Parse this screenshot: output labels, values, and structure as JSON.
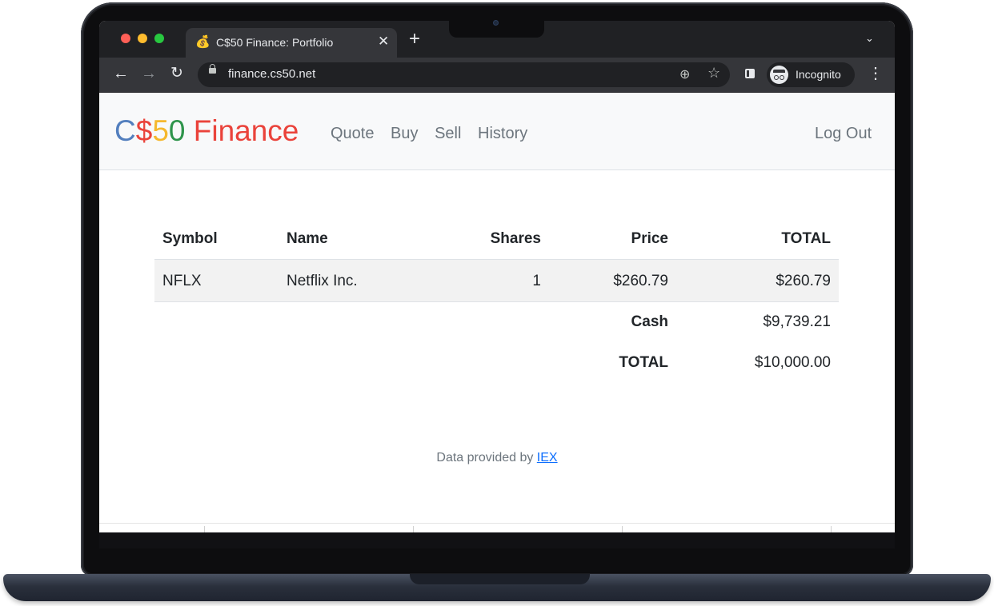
{
  "browser": {
    "tab_title": "C$50 Finance: Portfolio",
    "tab_favicon": "💰",
    "url": "finance.cs50.net",
    "profile_label": "Incognito",
    "icons": [
      "back-arrow-icon",
      "forward-arrow-icon",
      "reload-icon",
      "lock-icon",
      "zoom-icon",
      "star-icon",
      "side-panel-icon",
      "incognito-icon",
      "kebab-menu-icon",
      "close-icon",
      "plus-icon",
      "chevron-down-icon"
    ]
  },
  "navbar": {
    "brand": {
      "c": "C",
      "dollar": "$",
      "five": "5",
      "zero": "0",
      "finance": " Finance"
    },
    "brand_colors": {
      "blue": "#537fbe",
      "red": "#ea433b",
      "yellow": "#f5b82e",
      "green": "#2e944b"
    },
    "links": [
      "Quote",
      "Buy",
      "Sell",
      "History"
    ],
    "logout": "Log Out"
  },
  "portfolio": {
    "headers": {
      "symbol": "Symbol",
      "name": "Name",
      "shares": "Shares",
      "price": "Price",
      "total": "TOTAL"
    },
    "rows": [
      {
        "symbol": "NFLX",
        "name": "Netflix Inc.",
        "shares": "1",
        "price": "$260.79",
        "total": "$260.79"
      }
    ],
    "cash_label": "Cash",
    "cash_value": "$9,739.21",
    "grand_total_label": "TOTAL",
    "grand_total_value": "$10,000.00"
  },
  "footer": {
    "text": "Data provided by ",
    "link": "IEX",
    "link_color": "#0d6efd"
  }
}
